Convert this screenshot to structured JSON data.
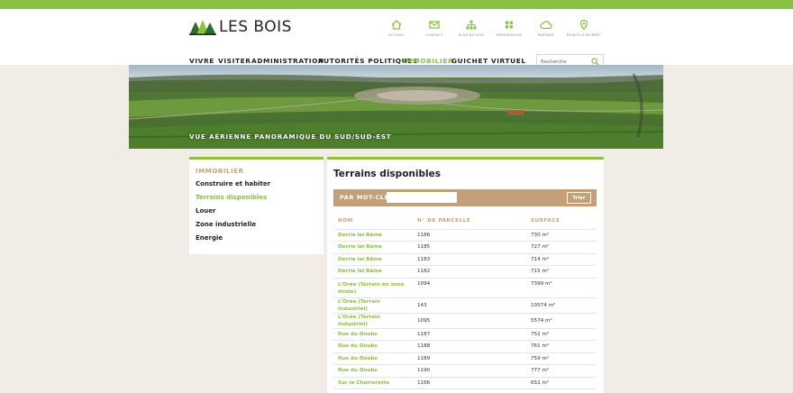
{
  "brand": {
    "name": "LES BOIS"
  },
  "quick_links": [
    {
      "label": "Accueil",
      "icon": "home-icon"
    },
    {
      "label": "Contact",
      "icon": "mail-icon"
    },
    {
      "label": "Plan du site",
      "icon": "sitemap-icon"
    },
    {
      "label": "Réservation",
      "icon": "reservation-icon"
    },
    {
      "label": "Partage",
      "icon": "cloud-icon"
    },
    {
      "label": "Points d'intérêt",
      "icon": "map-pin-icon"
    }
  ],
  "nav": [
    {
      "label": "VIVRE"
    },
    {
      "label": "VISITER"
    },
    {
      "label": "ADMINISTRATION"
    },
    {
      "label": "AUTORITÉS POLITIQUES"
    },
    {
      "label": "IMMOBILIER"
    },
    {
      "label": "GUICHET VIRTUEL"
    }
  ],
  "nav_active": "IMMOBILIER",
  "search": {
    "placeholder": "Recherche"
  },
  "hero": {
    "caption": "VUE AÉRIENNE PANORAMIQUE DU SUD/SUD-EST"
  },
  "sidebar": {
    "heading": "IMMOBILIER",
    "items": [
      {
        "label": "Construire et habiter"
      },
      {
        "label": "Terrains disponibles"
      },
      {
        "label": "Louer"
      },
      {
        "label": "Zone industrielle"
      },
      {
        "label": "Energie"
      }
    ],
    "active": "Terrains disponibles"
  },
  "main": {
    "title": "Terrains disponibles",
    "filter": {
      "label": "PAR MOT-CLÉ",
      "value": "",
      "button": "Trier"
    },
    "table": {
      "headers": [
        "NOM",
        "N° DE PARCELLE",
        "SURFACE"
      ],
      "rows": [
        {
          "name": "Derrie lai Bâme",
          "parcel": "1186",
          "surface": "730 m²"
        },
        {
          "name": "Derrie lai Bâme",
          "parcel": "1185",
          "surface": "727 m²"
        },
        {
          "name": "Derrie lai Bâme",
          "parcel": "1183",
          "surface": "714 m²"
        },
        {
          "name": "Derrie lai Bâme",
          "parcel": "1182",
          "surface": "715 m²"
        },
        {
          "name": "L'Orée (Terrain en zone mixte)",
          "parcel": "1094",
          "surface": "7399 m²"
        },
        {
          "name": "L'Orée (Terrain Industriel)",
          "parcel": "143",
          "surface": "10574 m²"
        },
        {
          "name": "L'Orée (Terrain Industriel)",
          "parcel": "1095",
          "surface": "5574 m²"
        },
        {
          "name": "Rue du Doubs",
          "parcel": "1187",
          "surface": "752 m²"
        },
        {
          "name": "Rue du Doubs",
          "parcel": "1188",
          "surface": "761 m²"
        },
        {
          "name": "Rue du Doubs",
          "parcel": "1189",
          "surface": "759 m²"
        },
        {
          "name": "Rue du Doubs",
          "parcel": "1190",
          "surface": "777 m²"
        },
        {
          "name": "Sur la Charrerette",
          "parcel": "1166",
          "surface": "652 m²"
        }
      ]
    }
  },
  "colors": {
    "green": "#8cc043",
    "tan": "#c3a07a",
    "background": "#f1ede6"
  }
}
